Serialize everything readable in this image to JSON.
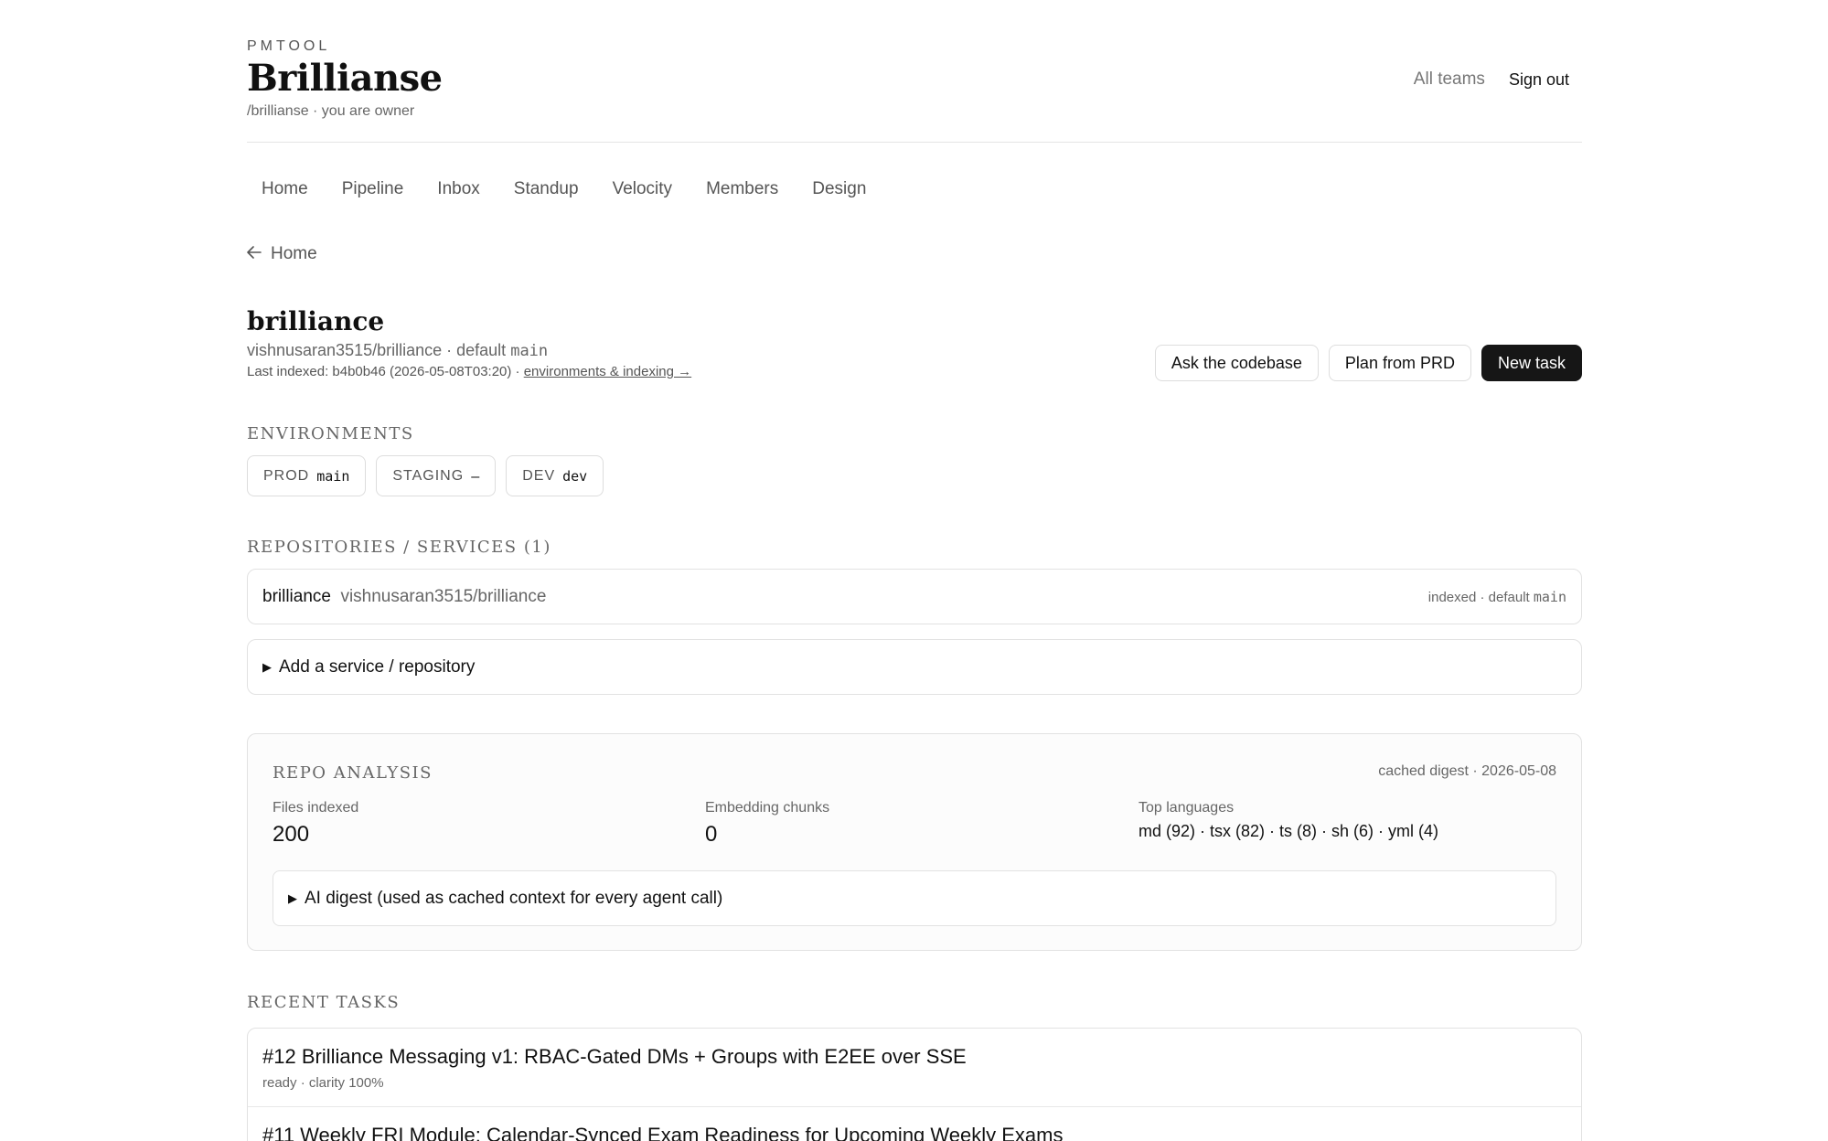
{
  "header": {
    "app_label": "PMTOOL",
    "team_title": "Brillianse",
    "team_sub": "/brillianse · you are owner",
    "all_teams": "All teams",
    "sign_out": "Sign out"
  },
  "nav": [
    "Home",
    "Pipeline",
    "Inbox",
    "Standup",
    "Velocity",
    "Members",
    "Design"
  ],
  "back": {
    "label": "Home"
  },
  "project": {
    "name": "brilliance",
    "repo_line": "vishnusaran3515/brilliance · default",
    "default_branch": "main",
    "last_indexed": "Last indexed: b4b0b46 (2026-05-08T03:20) ·",
    "env_link": "environments & indexing →"
  },
  "actions": {
    "ask": "Ask the codebase",
    "plan": "Plan from PRD",
    "new_task": "New task"
  },
  "environments": {
    "label": "ENVIRONMENTS",
    "items": [
      {
        "name": "PROD",
        "value": "main"
      },
      {
        "name": "STAGING",
        "value": "–"
      },
      {
        "name": "DEV",
        "value": "dev"
      }
    ]
  },
  "repositories": {
    "label": "REPOSITORIES / SERVICES (1)",
    "items": [
      {
        "name": "brilliance",
        "path": "vishnusaran3515/brilliance",
        "status": "indexed · default",
        "branch": "main"
      }
    ],
    "add_label": "Add a service / repository"
  },
  "analysis": {
    "title": "REPO ANALYSIS",
    "cached": "cached digest · 2026-05-08",
    "files_label": "Files indexed",
    "files_value": "200",
    "chunks_label": "Embedding chunks",
    "chunks_value": "0",
    "langs_label": "Top languages",
    "langs_value": "md (92) · tsx (82) · ts (8) · sh (6) · yml (4)",
    "digest_label": "AI digest (used as cached context for every agent call)"
  },
  "tasks": {
    "label": "RECENT TASKS",
    "items": [
      {
        "title": "#12 Brilliance Messaging v1: RBAC-Gated DMs + Groups with E2EE over SSE",
        "meta": "ready · clarity 100%"
      },
      {
        "title": "#11 Weekly FRI Module: Calendar-Synced Exam Readiness for Upcoming Weekly Exams",
        "meta": ""
      }
    ]
  }
}
